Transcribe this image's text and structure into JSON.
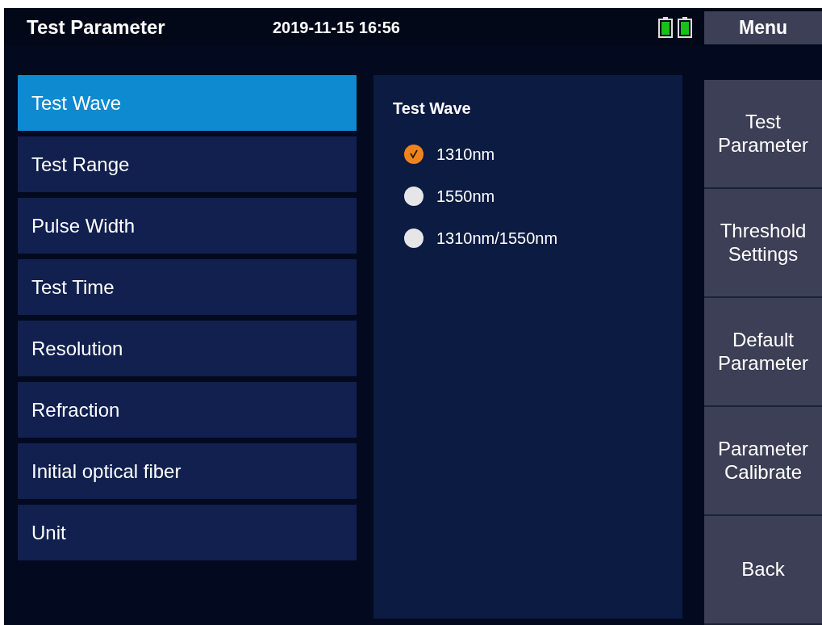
{
  "header": {
    "title": "Test Parameter",
    "datetime": "2019-11-15 16:56",
    "menu_label": "Menu"
  },
  "sidebar": {
    "items": [
      {
        "label": "Test Wave",
        "selected": true
      },
      {
        "label": "Test Range",
        "selected": false
      },
      {
        "label": "Pulse Width",
        "selected": false
      },
      {
        "label": "Test Time",
        "selected": false
      },
      {
        "label": "Resolution",
        "selected": false
      },
      {
        "label": "Refraction",
        "selected": false
      },
      {
        "label": "Initial optical fiber",
        "selected": false
      },
      {
        "label": "Unit",
        "selected": false
      }
    ]
  },
  "panel": {
    "title": "Test Wave",
    "options": [
      {
        "label": "1310nm",
        "selected": true
      },
      {
        "label": "1550nm",
        "selected": false
      },
      {
        "label": "1310nm/1550nm",
        "selected": false
      }
    ]
  },
  "menu": {
    "buttons": [
      "Test\nParameter",
      "Threshold\nSettings",
      "Default\nParameter",
      "Parameter\nCalibrate",
      "Back"
    ]
  }
}
